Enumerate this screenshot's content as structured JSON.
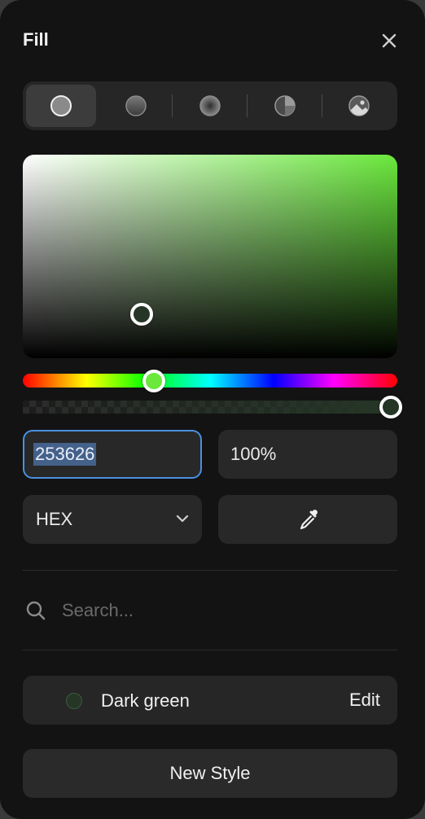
{
  "header": {
    "title": "Fill"
  },
  "fill_types": [
    {
      "name": "solid",
      "active": true
    },
    {
      "name": "linear-gradient",
      "active": false
    },
    {
      "name": "radial-gradient",
      "active": false
    },
    {
      "name": "conic-gradient",
      "active": false
    },
    {
      "name": "image",
      "active": false
    }
  ],
  "color": {
    "hex_value": "253626",
    "alpha_value": "100%",
    "mode": "HEX",
    "hue_color": "#6ae83c",
    "current_color": "#253626"
  },
  "search": {
    "placeholder": "Search..."
  },
  "styles": [
    {
      "name": "Dark green",
      "edit_label": "Edit",
      "color": "#253626"
    }
  ],
  "new_style_label": "New Style"
}
